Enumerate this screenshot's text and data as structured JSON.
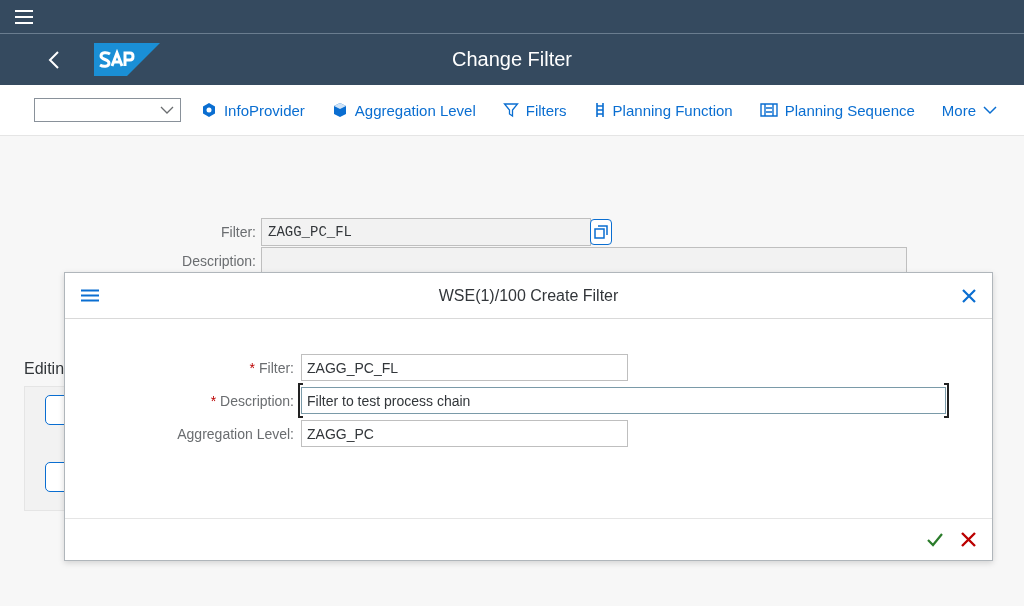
{
  "shell": {
    "title": "Change Filter"
  },
  "toolbar": {
    "items": [
      {
        "kind": "infoprovider",
        "label": "InfoProvider"
      },
      {
        "kind": "aggregation",
        "label": "Aggregation Level"
      },
      {
        "kind": "filter",
        "label": "Filters"
      },
      {
        "kind": "function",
        "label": "Planning Function"
      },
      {
        "kind": "sequence",
        "label": "Planning Sequence"
      },
      {
        "kind": "more",
        "label": "More"
      }
    ]
  },
  "form": {
    "fields": [
      {
        "label": "Filter:",
        "value": "ZAGG_PC_FL"
      },
      {
        "label": "Description:"
      }
    ],
    "section_title": "Editin"
  },
  "dialog": {
    "title": "WSE(1)/100 Create Filter",
    "fields": [
      {
        "label": "Filter:",
        "required_mark": "*",
        "value": "ZAGG_PC_FL",
        "wide": false,
        "focused": false
      },
      {
        "label": "Description:",
        "required_mark": "*",
        "value": "Filter to test process chain",
        "wide": true,
        "focused": true
      },
      {
        "label": "Aggregation Level:",
        "value": "ZAGG_PC",
        "wide": false,
        "focused": false
      }
    ]
  }
}
